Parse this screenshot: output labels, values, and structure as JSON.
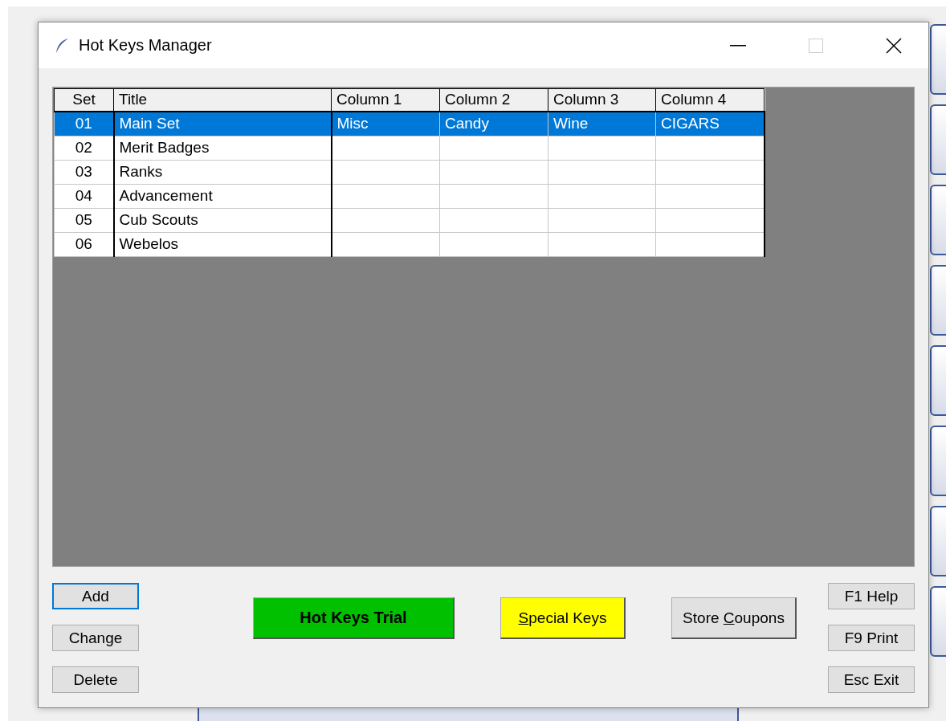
{
  "window": {
    "title": "Hot Keys Manager"
  },
  "table": {
    "columns": [
      "Set",
      "Title",
      "Column 1",
      "Column 2",
      "Column 3",
      "Column 4"
    ],
    "rows": [
      {
        "cells": [
          "01",
          "Main Set",
          "Misc",
          "Candy",
          "Wine",
          "CIGARS"
        ],
        "selected": true
      },
      {
        "cells": [
          "02",
          "Merit Badges",
          "",
          "",
          "",
          ""
        ],
        "selected": false
      },
      {
        "cells": [
          "03",
          "Ranks",
          "",
          "",
          "",
          ""
        ],
        "selected": false
      },
      {
        "cells": [
          "04",
          "Advancement",
          "",
          "",
          "",
          ""
        ],
        "selected": false
      },
      {
        "cells": [
          "05",
          "Cub Scouts",
          "",
          "",
          "",
          ""
        ],
        "selected": false
      },
      {
        "cells": [
          "06",
          "Webelos",
          "",
          "",
          "",
          ""
        ],
        "selected": false
      }
    ]
  },
  "left_buttons": [
    {
      "label": "Add",
      "focused": true
    },
    {
      "label": "Change",
      "focused": false
    },
    {
      "label": "Delete",
      "focused": false
    }
  ],
  "center_buttons": [
    {
      "kind": "bold",
      "before": "Hot Keys Trial",
      "color": "#00c000"
    },
    {
      "kind": "plain",
      "key": "S",
      "after": "pecial Keys",
      "color": "#ffff00"
    },
    {
      "kind": "plain",
      "before": "Store ",
      "key": "C",
      "after": "oupons",
      "color": "#e1e1e1"
    }
  ],
  "right_buttons": [
    "F1 Help",
    "F9 Print",
    "Esc Exit"
  ]
}
